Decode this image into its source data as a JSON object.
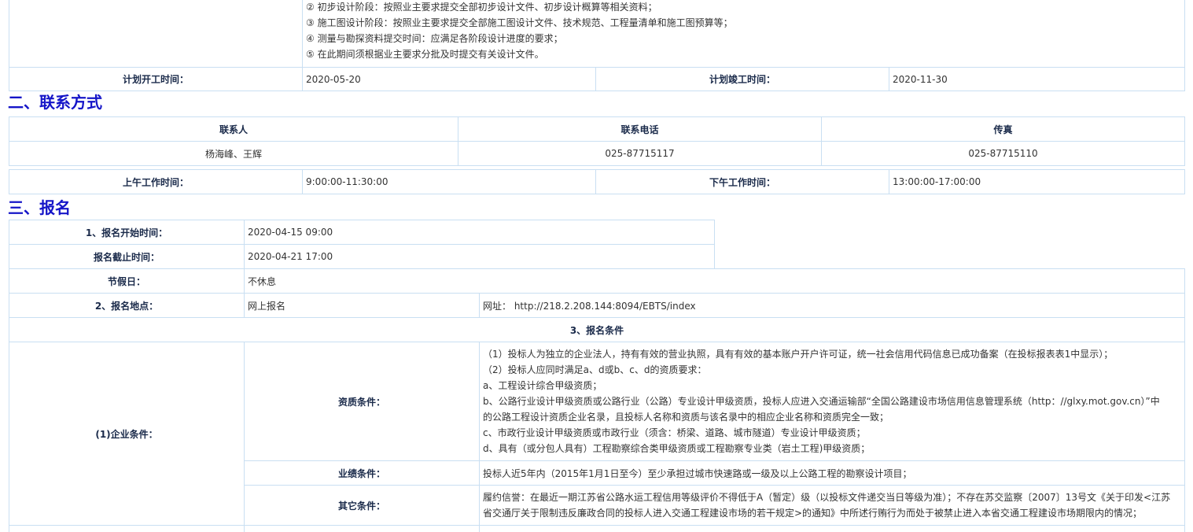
{
  "top_table": {
    "design_items": [
      "② 初步设计阶段：按照业主要求提交全部初步设计文件、初步设计概算等相关资料；",
      "③ 施工图设计阶段：按照业主要求提交全部施工图设计文件、技术规范、工程量清单和施工图预算等；",
      "④ 测量与勘探资料提交时间：应满足各阶段设计进度的要求；",
      "⑤ 在此期间须根据业主要求分批及时提交有关设计文件。"
    ],
    "plan_start_label": "计划开工时间：",
    "plan_start_value": "2020-05-20",
    "plan_end_label": "计划竣工时间：",
    "plan_end_value": "2020-11-30"
  },
  "section2": {
    "heading": "二、联系方式",
    "headers": [
      "联系人",
      "联系电话",
      "传真"
    ],
    "values": [
      "杨海峰、王辉",
      "025-87715117",
      "025-87715110"
    ],
    "am_label": "上午工作时间：",
    "am_value": "9:00:00-11:30:00",
    "pm_label": "下午工作时间：",
    "pm_value": "13:00:00-17:00:00"
  },
  "section3": {
    "heading": "三、报名",
    "start_label": "1、报名开始时间：",
    "start_value": "2020-04-15 09:00",
    "end_label": "报名截止时间：",
    "end_value": "2020-04-21 17:00",
    "holiday_label": "节假日：",
    "holiday_value": "不休息",
    "place_label": "2、报名地点：",
    "place_value": "网上报名",
    "url_text": "网址： http://218.2.208.144:8094/EBTS/index",
    "conditions_title": "3、报名条件",
    "company_label": "(1)企业条件：",
    "qual_label": "资质条件：",
    "qual_lines": [
      "（1）投标人为独立的企业法人，持有有效的营业执照，具有有效的基本账户开户许可证，统一社会信用代码信息已成功备案（在投标报表表1中显示）；",
      "（2）投标人应同时满足a、d或b、c、d的资质要求：",
      "a、工程设计综合甲级资质；",
      "b、公路行业设计甲级资质或公路行业（公路）专业设计甲级资质，投标人应进入交通运输部“全国公路建设市场信用信息管理系统（http：//glxy.mot.gov.cn）”中",
      "的公路工程设计资质企业名录，且投标人名称和资质与该名录中的相应企业名称和资质完全一致；",
      "c、市政行业设计甲级资质或市政行业（须含：桥梁、道路、城市隧道）专业设计甲级资质；",
      "d、具有（或分包人具有）工程勘察综合类甲级资质或工程勘察专业类（岩土工程)甲级资质；"
    ],
    "perf_label": "业绩条件：",
    "perf_value": "投标人近5年内（2015年1月1日至今）至少承担过城市快速路或一级及以上公路工程的勘察设计项目；",
    "other_label": "其它条件：",
    "other_lines": [
      "履约信誉：在最近一期江苏省公路水运工程信用等级评价不得低于A（暂定）级（以投标文件递交当日等级为准）；不存在苏交监察〔2007〕13号文《关于印发<江苏",
      "省交通厅关于限制违反廉政合同的投标人进入交通工程建设市场的若干规定>的通知》中所述行贿行为而处于被禁止进入本省交通工程建设市场期限内的情况；"
    ]
  }
}
